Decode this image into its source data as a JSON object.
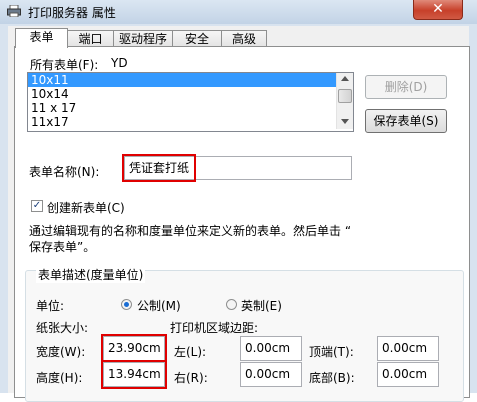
{
  "window": {
    "title": "打印服务器 属性",
    "close_glyph": "✕"
  },
  "tabs": [
    {
      "label": "表单",
      "active": true
    },
    {
      "label": "端口"
    },
    {
      "label": "驱动程序"
    },
    {
      "label": "安全"
    },
    {
      "label": "高级"
    }
  ],
  "forms": {
    "all_forms_label": "所有表单(F):",
    "server_name": "YD",
    "list_items": [
      "10x11",
      "10x14",
      "11 x 17",
      "11x17"
    ],
    "selected_index": 0,
    "delete_button": "删除(D)",
    "save_button": "保存表单(S)"
  },
  "form_name": {
    "label": "表单名称(N):",
    "value": "凭证套打纸"
  },
  "create_new": {
    "label": "创建新表单(C)",
    "checked": true
  },
  "hint": {
    "line1": "通过编辑现有的名称和度量单位来定义新的表单。然后单击 “",
    "line2": "保存表单”。"
  },
  "description": {
    "group_label": "表单描述(度量单位)",
    "unit_label": "单位:",
    "metric_label": "公制(M)",
    "english_label": "英制(E)",
    "metric_selected": true,
    "paper_size_label": "纸张大小:",
    "printer_margins_label": "打印机区域边距:",
    "width_label": "宽度(W):",
    "width_value": "23.90cm",
    "height_label": "高度(H):",
    "height_value": "13.94cm",
    "left_label": "左(L):",
    "left_value": "0.00cm",
    "right_label": "右(R):",
    "right_value": "0.00cm",
    "top_label": "顶端(T):",
    "top_value": "0.00cm",
    "bottom_label": "底部(B):",
    "bottom_value": "0.00cm"
  },
  "colors": {
    "highlight_outline": "#e00000",
    "selection": "#3399ff",
    "close_button": "#c7402a"
  }
}
